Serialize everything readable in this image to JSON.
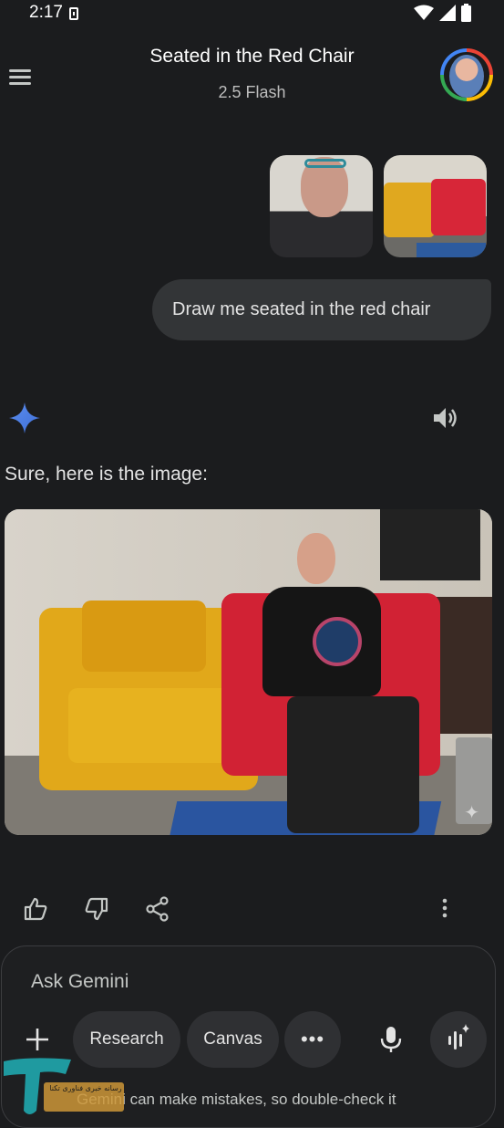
{
  "status_bar": {
    "time": "2:17",
    "icons": [
      "sim-card-icon",
      "wifi-icon",
      "signal-icon",
      "battery-icon"
    ]
  },
  "header": {
    "title": "Seated in the Red Chair",
    "model": "2.5 Flash"
  },
  "conversation": {
    "user_images": [
      "selfie-photo",
      "chairs-photo"
    ],
    "user_message": "Draw me seated in the red chair",
    "reply_text": "Sure, here is the image:",
    "generated_image": "man-seated-in-red-chair"
  },
  "actions": [
    "thumbs-up-icon",
    "thumbs-down-icon",
    "share-icon",
    "more-vert-icon"
  ],
  "composer": {
    "placeholder": "Ask Gemini",
    "chips": {
      "research": "Research",
      "canvas": "Canvas",
      "more": "•••"
    }
  },
  "disclaimer": "Gemini can make mistakes, so double-check it",
  "watermark": {
    "text": "رسانه خبری فناوری تکنا"
  },
  "colors": {
    "background": "#1b1c1e",
    "bubble": "#333537",
    "chip": "#2f3033",
    "accent_blue": "#4285f4"
  }
}
